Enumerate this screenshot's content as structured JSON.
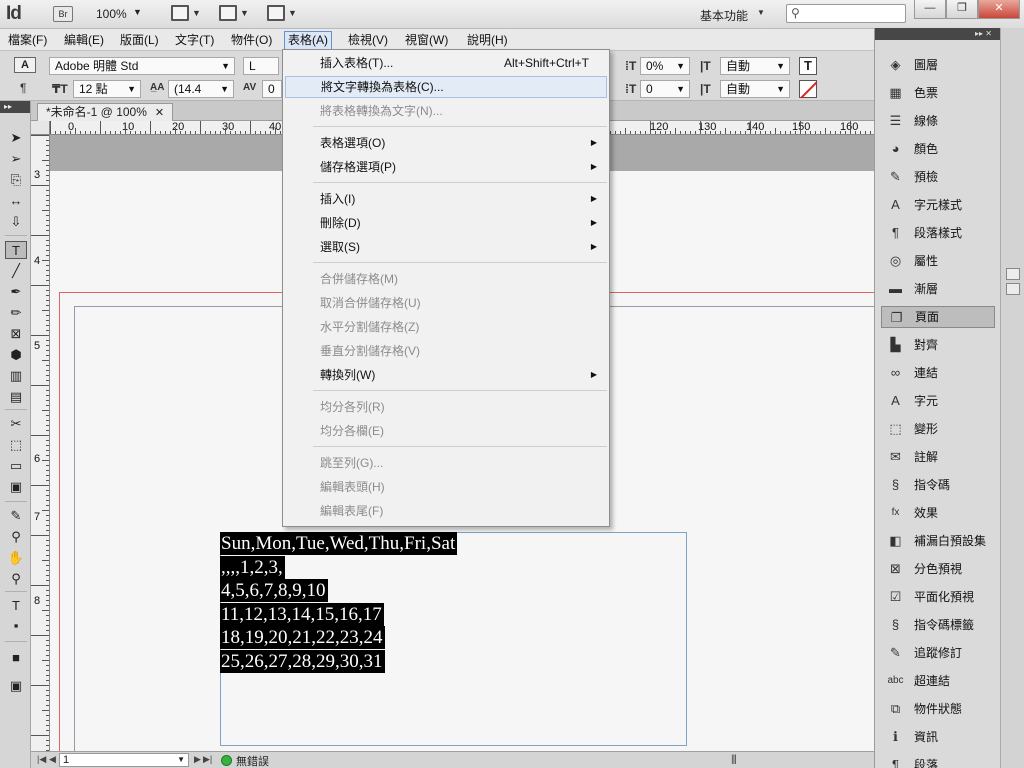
{
  "app": {
    "logo": "Id",
    "bridge": "Br",
    "zoom": "100%",
    "workspace": "基本功能",
    "search_icon": "search-icon",
    "window_buttons": [
      "—",
      "❐",
      "✕"
    ]
  },
  "menubar": [
    "檔案(F)",
    "編輯(E)",
    "版面(L)",
    "文字(T)",
    "物件(O)",
    "表格(A)",
    "檢視(V)",
    "視窗(W)",
    "說明(H)"
  ],
  "control": {
    "font_family": "Adobe 明體 Std",
    "font_style": "L",
    "font_size": "12 點",
    "leading": "(14.4",
    "tracking_prefix": "0",
    "tracking": "0%",
    "baseline": "0",
    "auto1": "自動",
    "auto2": "自動",
    "stroke_t": "T"
  },
  "doc_tab": "*未命名-1 @ 100%",
  "ruler_h": [
    "0",
    "10",
    "20",
    "30",
    "40",
    "120",
    "130",
    "140",
    "150",
    "160"
  ],
  "ruler_v": [
    "3",
    "4",
    "5",
    "6",
    "7",
    "8"
  ],
  "table_menu": {
    "items": [
      {
        "label": "插入表格(T)...",
        "shortcut": "Alt+Shift+Ctrl+T",
        "enabled": true
      },
      {
        "label": "將文字轉換為表格(C)...",
        "enabled": true,
        "hover": true
      },
      {
        "label": "將表格轉換為文字(N)...",
        "enabled": false
      },
      {
        "label": "表格選項(O)",
        "enabled": true,
        "submenu": true
      },
      {
        "label": "儲存格選項(P)",
        "enabled": true,
        "submenu": true
      },
      {
        "label": "插入(I)",
        "enabled": true,
        "submenu": true
      },
      {
        "label": "刪除(D)",
        "enabled": true,
        "submenu": true
      },
      {
        "label": "選取(S)",
        "enabled": true,
        "submenu": true
      },
      {
        "label": "合併儲存格(M)",
        "enabled": false
      },
      {
        "label": "取消合併儲存格(U)",
        "enabled": false
      },
      {
        "label": "水平分割儲存格(Z)",
        "enabled": false
      },
      {
        "label": "垂直分割儲存格(V)",
        "enabled": false
      },
      {
        "label": "轉換列(W)",
        "enabled": true,
        "submenu": true
      },
      {
        "label": "均分各列(R)",
        "enabled": false
      },
      {
        "label": "均分各欄(E)",
        "enabled": false
      },
      {
        "label": "跳至列(G)...",
        "enabled": false
      },
      {
        "label": "編輯表頭(H)",
        "enabled": false
      },
      {
        "label": "編輯表尾(F)",
        "enabled": false
      }
    ]
  },
  "text_lines": [
    "Sun,Mon,Tue,Wed,Thu,Fri,Sat",
    ",,,,1,2,3,",
    "4,5,6,7,8,9,10",
    "11,12,13,14,15,16,17",
    "18,19,20,21,22,23,24",
    "25,26,27,28,29,30,31"
  ],
  "status": {
    "page": "1",
    "preflight": "無錯誤"
  },
  "panels": [
    {
      "label": "圖層",
      "icon": "layers-icon",
      "glyph": "◈"
    },
    {
      "label": "色票",
      "icon": "swatches-icon",
      "glyph": "▦"
    },
    {
      "label": "線條",
      "icon": "stroke-icon",
      "glyph": "☰"
    },
    {
      "label": "顏色",
      "icon": "color-icon",
      "glyph": "◕"
    },
    {
      "label": "預檢",
      "icon": "preflight-icon",
      "glyph": "✎"
    },
    {
      "label": "字元樣式",
      "icon": "character-styles-icon",
      "glyph": "A"
    },
    {
      "label": "段落樣式",
      "icon": "paragraph-styles-icon",
      "glyph": "¶"
    },
    {
      "label": "屬性",
      "icon": "attributes-icon",
      "glyph": "◎"
    },
    {
      "label": "漸層",
      "icon": "gradient-icon",
      "glyph": "▬"
    },
    {
      "label": "頁面",
      "icon": "pages-icon",
      "glyph": "❐",
      "selected": true
    },
    {
      "label": "對齊",
      "icon": "align-icon",
      "glyph": "▙"
    },
    {
      "label": "連結",
      "icon": "links-icon",
      "glyph": "∞"
    },
    {
      "label": "字元",
      "icon": "character-icon",
      "glyph": "A"
    },
    {
      "label": "變形",
      "icon": "transform-icon",
      "glyph": "⬚"
    },
    {
      "label": "註解",
      "icon": "notes-icon",
      "glyph": "✉"
    },
    {
      "label": "指令碼",
      "icon": "scripts-icon",
      "glyph": "§"
    },
    {
      "label": "效果",
      "icon": "effects-icon",
      "glyph": "fx"
    },
    {
      "label": "補漏白預設集",
      "icon": "trap-presets-icon",
      "glyph": "◧"
    },
    {
      "label": "分色預視",
      "icon": "separations-icon",
      "glyph": "⊠"
    },
    {
      "label": "平面化預視",
      "icon": "flattener-icon",
      "glyph": "☑"
    },
    {
      "label": "指令碼標籤",
      "icon": "script-label-icon",
      "glyph": "§"
    },
    {
      "label": "追蹤修訂",
      "icon": "track-changes-icon",
      "glyph": "✎"
    },
    {
      "label": "超連結",
      "icon": "hyperlinks-icon",
      "glyph": "abc"
    },
    {
      "label": "物件狀態",
      "icon": "object-states-icon",
      "glyph": "⧉"
    },
    {
      "label": "資訊",
      "icon": "info-icon",
      "glyph": "ℹ"
    },
    {
      "label": "段落",
      "icon": "paragraph-icon",
      "glyph": "¶"
    }
  ],
  "tools": [
    {
      "name": "selection-tool-icon",
      "glyph": "➤"
    },
    {
      "name": "direct-selection-tool-icon",
      "glyph": "➢"
    },
    {
      "name": "page-tool-icon",
      "glyph": "⎘"
    },
    {
      "name": "gap-tool-icon",
      "glyph": "↔"
    },
    {
      "name": "content-collector-icon",
      "glyph": "⇩"
    },
    {
      "name": "type-tool-icon",
      "glyph": "T",
      "selected": true
    },
    {
      "name": "line-tool-icon",
      "glyph": "╱"
    },
    {
      "name": "pen-tool-icon",
      "glyph": "✒"
    },
    {
      "name": "pencil-tool-icon",
      "glyph": "✏"
    },
    {
      "name": "rectangle-frame-tool-icon",
      "glyph": "⊠"
    },
    {
      "name": "ellipse-tool-icon",
      "glyph": "⬢"
    },
    {
      "name": "table-tool-icon",
      "glyph": "▥"
    },
    {
      "name": "grid-tool-icon",
      "glyph": "▤"
    },
    {
      "name": "scissors-tool-icon",
      "glyph": "✂"
    },
    {
      "name": "free-transform-tool-icon",
      "glyph": "⬚"
    },
    {
      "name": "gradient-swatch-tool-icon",
      "glyph": "▭"
    },
    {
      "name": "gradient-feather-tool-icon",
      "glyph": "▣"
    },
    {
      "name": "note-tool-icon",
      "glyph": "✎"
    },
    {
      "name": "eyedropper-tool-icon",
      "glyph": "⚲"
    },
    {
      "name": "hand-tool-icon",
      "glyph": "✋"
    },
    {
      "name": "zoom-tool-icon",
      "glyph": "⚲"
    },
    {
      "name": "fill-stroke-icon",
      "glyph": "T"
    },
    {
      "name": "apply-color-icon",
      "glyph": "▪"
    },
    {
      "name": "view-mode-icon",
      "glyph": "■"
    },
    {
      "name": "screen-mode-icon",
      "glyph": "▣"
    }
  ]
}
